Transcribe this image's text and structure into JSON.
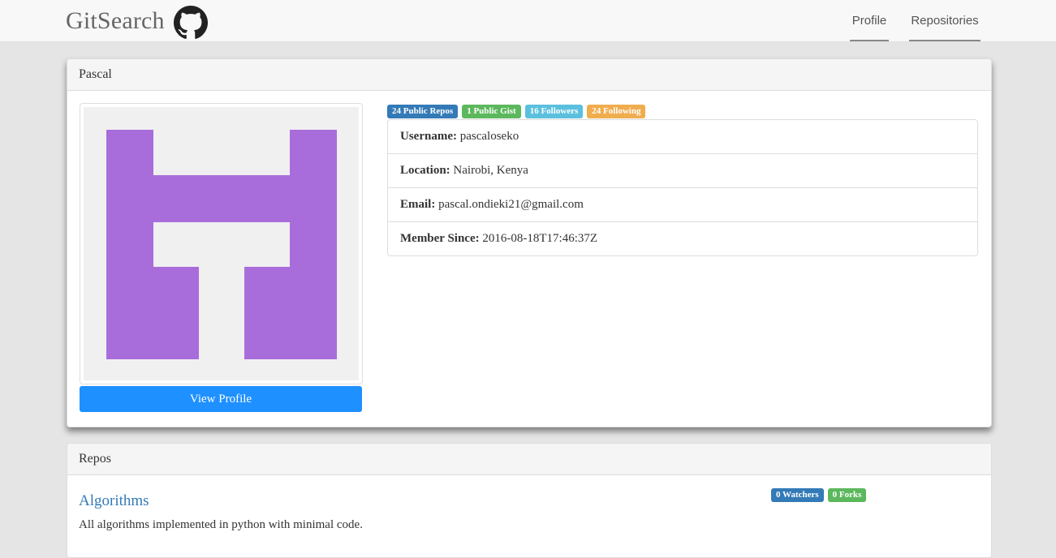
{
  "app": {
    "brand": "GitSearch"
  },
  "nav": {
    "profile_label": "Profile",
    "repositories_label": "Repositories"
  },
  "profile": {
    "heading": "Pascal",
    "view_button": "View Profile",
    "badges": {
      "repos": "24 Public Repos",
      "gists": "1 Public Gist",
      "followers": "16 Followers",
      "following": "24 Following"
    },
    "fields": {
      "username_label": "Username:",
      "username_value": "pascaloseko",
      "location_label": "Location:",
      "location_value": "Nairobi, Kenya",
      "email_label": "Email:",
      "email_value": "pascal.ondieki21@gmail.com",
      "member_label": "Member Since:",
      "member_value": "2016-08-18T17:46:37Z"
    },
    "avatar_color": "#a96ddb"
  },
  "repos": {
    "heading": "Repos",
    "items": [
      {
        "name": "Algorithms",
        "description": "All algorithms implemented in python with minimal code.",
        "watchers": "0 Watchers",
        "forks": "0 Forks"
      }
    ]
  }
}
